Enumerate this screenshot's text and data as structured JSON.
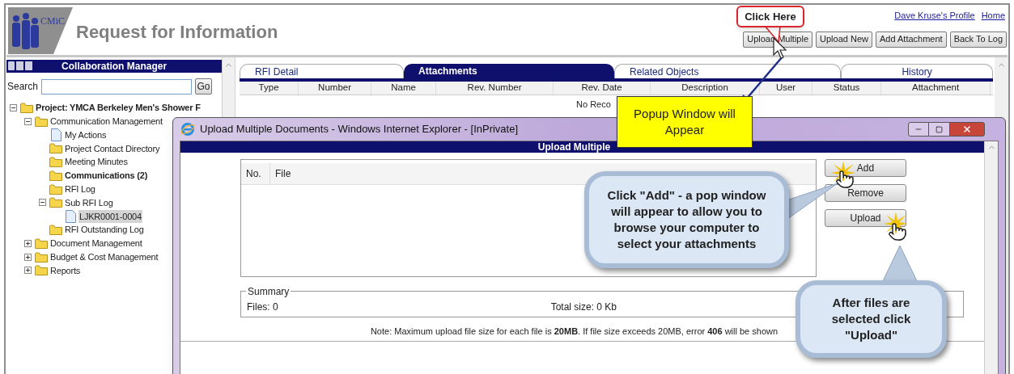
{
  "header": {
    "logo_text": "CMiC",
    "title": "Request for Information",
    "links": [
      "Dave Kruse's Profile",
      "Home"
    ],
    "buttons": [
      "Upload Multiple",
      "Upload New",
      "Add Attachment",
      "Back To Log"
    ]
  },
  "sidebar": {
    "title": "Collaboration Manager",
    "search": {
      "label": "Search",
      "button": "Go"
    },
    "tree": [
      {
        "label": "Project: YMCA Berkeley Men's Shower F",
        "kind": "folder",
        "bold": true,
        "selected": false,
        "expanded": true,
        "children": [
          {
            "label": "Communication Management",
            "kind": "folder",
            "bold": false,
            "selected": false,
            "expanded": true,
            "children": [
              {
                "label": "My Actions",
                "kind": "document",
                "bold": false,
                "selected": false
              },
              {
                "label": "Project Contact Directory",
                "kind": "folder",
                "bold": false,
                "selected": false
              },
              {
                "label": "Meeting Minutes",
                "kind": "folder",
                "bold": false,
                "selected": false
              },
              {
                "label": "Communications (2)",
                "kind": "folder",
                "bold": true,
                "selected": false
              },
              {
                "label": "RFI Log",
                "kind": "folder",
                "bold": false,
                "selected": false
              },
              {
                "label": "Sub RFI Log",
                "kind": "folder",
                "bold": false,
                "selected": false,
                "expanded": true,
                "children": [
                  {
                    "label": "LJKR0001-0004",
                    "kind": "document",
                    "bold": false,
                    "selected": true
                  }
                ]
              },
              {
                "label": "RFI Outstanding Log",
                "kind": "folder",
                "bold": false,
                "selected": false
              }
            ]
          },
          {
            "label": "Document Management",
            "kind": "folder",
            "bold": false,
            "selected": false,
            "expanded": false
          },
          {
            "label": "Budget & Cost Management",
            "kind": "folder",
            "bold": false,
            "selected": false,
            "expanded": false
          },
          {
            "label": "Reports",
            "kind": "folder",
            "bold": false,
            "selected": false,
            "expanded": false
          }
        ]
      }
    ]
  },
  "main": {
    "tabs": [
      {
        "label": "RFI Detail",
        "selected": false
      },
      {
        "label": "Attachments",
        "selected": true
      },
      {
        "label": "Related Objects",
        "selected": false
      },
      {
        "label": "History",
        "selected": false
      }
    ],
    "columns": [
      "Type",
      "Number",
      "Name",
      "Rev. Number",
      "Rev. Date",
      "Description",
      "User",
      "Status",
      "Attachment"
    ],
    "empty_message": "No Reco"
  },
  "popup": {
    "title": "Upload Multiple Documents - Windows Internet Explorer - [InPrivate]",
    "header": "Upload Multiple",
    "file_columns": [
      "No.",
      "File"
    ],
    "buttons": [
      "Add",
      "Remove",
      "Upload"
    ],
    "summary": {
      "legend": "Summary",
      "files": "Files: 0",
      "total_size": "Total size: 0 Kb"
    },
    "note": "Note: Maximum upload file size for each file is **20MB**. If file size exceeds 20MB, error **406** will be shown"
  },
  "annotations": [
    {
      "kind": "tag",
      "text": "Click Here"
    },
    {
      "kind": "note",
      "text": "Popup Window will Appear"
    },
    {
      "kind": "bubble",
      "text": "Click \"Add\" - a pop window will appear to allow you to browse your computer to select your attachments"
    },
    {
      "kind": "bubble",
      "text": "After files are selected click \"Upload\""
    }
  ]
}
